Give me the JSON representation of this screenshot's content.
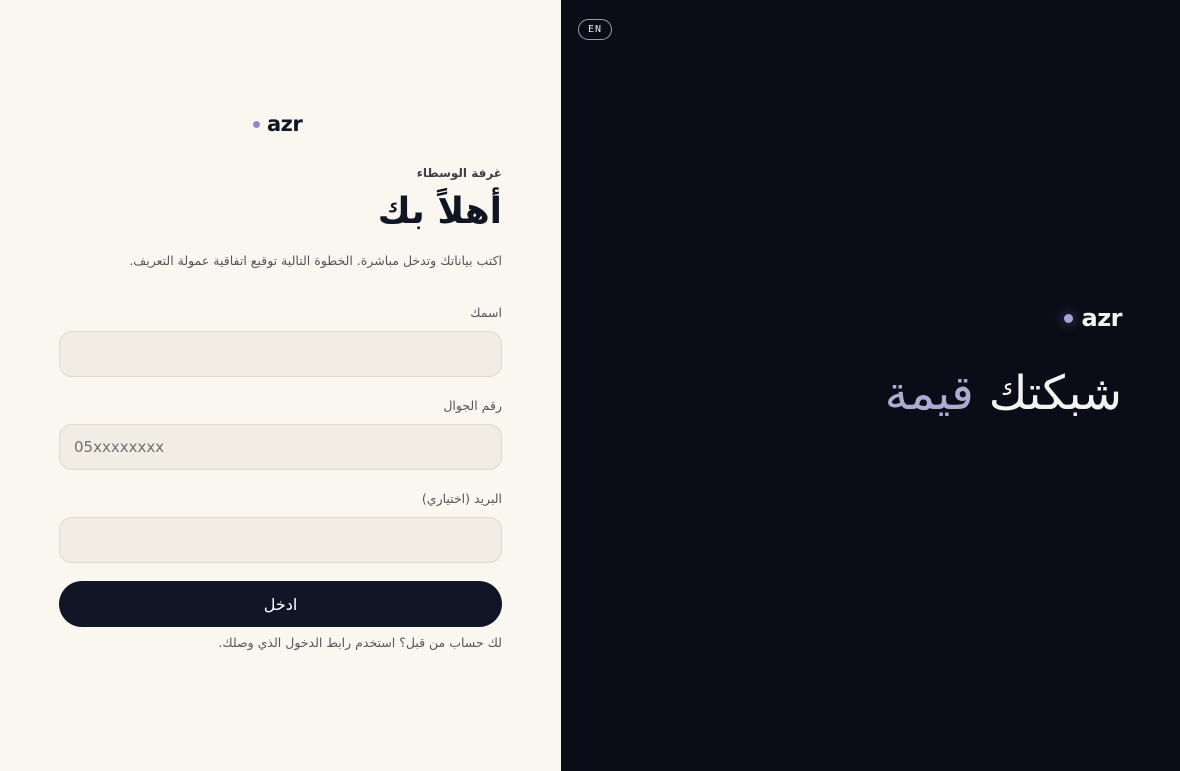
{
  "brand": {
    "logo_text": "azr"
  },
  "form": {
    "eyebrow": "غرفة الوسطاء",
    "title": "أهلاً بك",
    "subtitle": "اكتب بياناتك وتدخل مباشرة. الخطوة التالية توقيع اتفاقية عمولة التعريف.",
    "fields": {
      "name": {
        "label": "اسمك",
        "value": "",
        "placeholder": ""
      },
      "phone": {
        "label": "رقم الجوال",
        "value": "",
        "placeholder": "05xxxxxxxx"
      },
      "email": {
        "label": "البريد (اختياري)",
        "value": "",
        "placeholder": ""
      }
    },
    "submit_label": "ادخل",
    "footnote": "لك حساب من قبل؟ استخدم رابط الدخول الذي وصلك."
  },
  "hero": {
    "lang_toggle": "EN",
    "headline_main": "شبكتك",
    "headline_accent": "قيمة"
  },
  "colors": {
    "panel_light": "#faf7f1",
    "panel_dark": "#0a0c18",
    "button": "#101626",
    "accent": "#aeaad2",
    "logo_dot": "#8f8bc2",
    "input_bg": "#f2ede4",
    "input_border": "#e3d9c6"
  },
  "icons": {
    "logo_mark": "dot-icon"
  }
}
